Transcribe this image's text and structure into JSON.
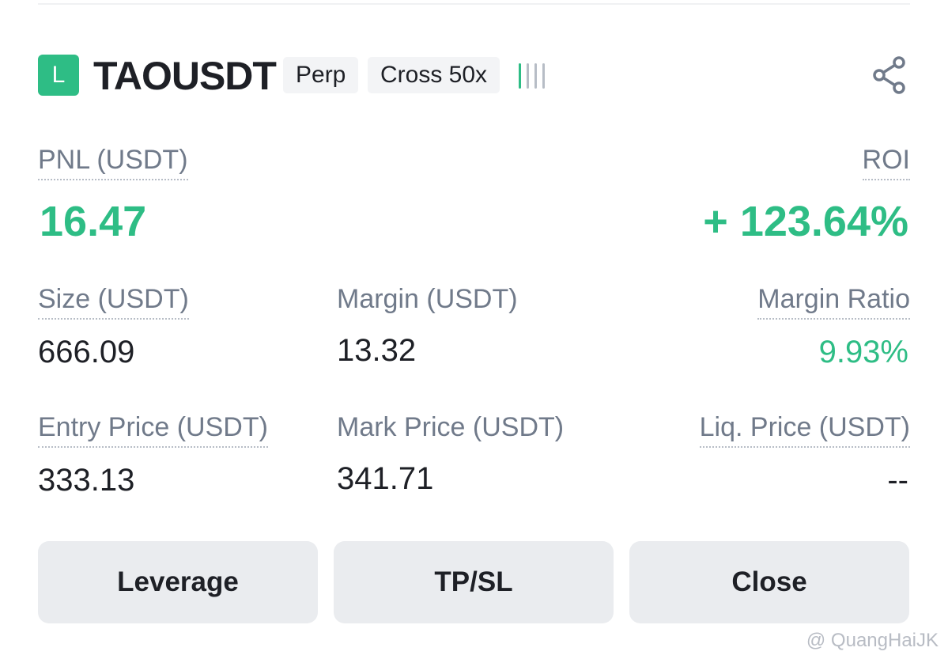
{
  "position": {
    "side_badge": "L",
    "symbol": "TAOUSDT",
    "contract_type": "Perp",
    "margin_mode": "Cross 50x",
    "signal_icon": "signal-bars-icon",
    "share_icon": "share-icon"
  },
  "pnl": {
    "label": "PNL (USDT)",
    "value": "16.47"
  },
  "roi": {
    "label": "ROI",
    "value": "+ 123.64%"
  },
  "size": {
    "label": "Size (USDT)",
    "value": "666.09"
  },
  "margin": {
    "label": "Margin (USDT)",
    "value": "13.32"
  },
  "margin_ratio": {
    "label": "Margin Ratio",
    "value": "9.93%"
  },
  "entry_price": {
    "label": "Entry Price (USDT)",
    "value": "333.13"
  },
  "mark_price": {
    "label": "Mark Price (USDT)",
    "value": "341.71"
  },
  "liq_price": {
    "label": "Liq. Price (USDT)",
    "value": "--"
  },
  "actions": {
    "leverage": "Leverage",
    "tpsl": "TP/SL",
    "close": "Close"
  },
  "watermark": "@ QuangHaiJK",
  "colors": {
    "positive": "#2ebd85",
    "muted": "#707a8a",
    "button_bg": "#eaecef",
    "text": "#1e2026"
  }
}
